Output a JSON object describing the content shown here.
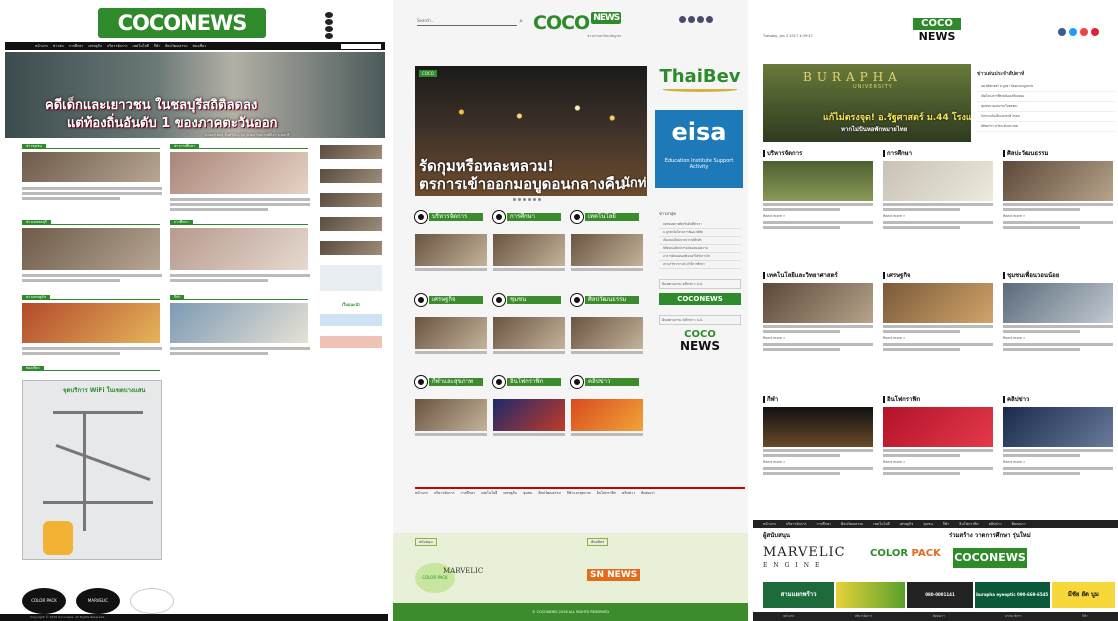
{
  "panel1": {
    "logo": "COCONEWS",
    "nav_items": [
      "หน้าแรก",
      "ข่าวสด",
      "การศึกษา",
      "เศรษฐกิจ",
      "บริหารจัดการ",
      "เทคโนโลยี",
      "กีฬา",
      "ศิลปวัฒนธรรม",
      "ท่องเที่ยว"
    ],
    "hero_caption_1": "คดีเด็กและเยาวชน ในชลบุรีสถิติลดลง",
    "hero_caption_2": "แต่ท้องถิ่นอันดับ 1 ของภาคตะวันออก",
    "hero_caption_small": "นายสุรเชษฐ์ จันทร์เพ็ญ ผู้อำนวยการสถานพินิจฯ จ.ชลบุรี",
    "sections_left": [
      "ข่าวชุมชน",
      "ข่าวเด่นชลบุรี",
      "ข่าวเศรษฐกิจ",
      "ท่องเที่ยว"
    ],
    "sections_right": [
      "ข่าวการศึกษา",
      "การศึกษา",
      "กีฬา"
    ],
    "map_title": "จุดบริการ WiFi ในเขตบางแสน",
    "sidebar_label": "เว็บแนะนำ",
    "footer_logos": [
      "COLOR PACK",
      "MARVELIC",
      ""
    ],
    "footer": "Copyright © 2015 Coconews. All Rights Reserved."
  },
  "panel2": {
    "search_placeholder": "Search...",
    "logo": "COCO",
    "logo_badge": "NEWS",
    "logo_tag": "ข่าวสารมหาวิทยาลัยบูรพา",
    "hero_badge": "COCO",
    "hero_caption_1": "รัดกุมหรือหละหลวม!",
    "hero_caption_2": "ตรการเข้าออกมอบูดอนกลางคืน",
    "hero_caption_3": "นักท่อ",
    "sponsor_1": "ThaiBev",
    "sponsor_2_title": "eisa",
    "sponsor_2_sub": "Education Institute Support Activity",
    "categories": [
      "บริหารจัดการ",
      "การศึกษา",
      "เทคโนโลยี",
      "เศรษฐกิจ",
      "ชุมชน",
      "ศิลปวัฒนธรรม",
      "กีฬาและสุขภาพ",
      "อินโฟกราฟิก",
      "คลิปข่าว"
    ],
    "side_heading": "ข่าวล่าสุด",
    "side_items": [
      "ลดขยะพลาสติกเริ่มต้นที่ตัวเรา",
      "ม.บูรพาจัดโครงการพัฒนานิสิต",
      "เปิดเทอมใหม่บรรยากาศคึกคัก",
      "นิสิตคณะศิลปกรรมจัดแสดงผลงาน",
      "อาจารย์สอนคอมพิวเตอร์ได้รับรางวัล",
      "เสวนาวิชาการประจำปีการศึกษา"
    ],
    "side_box_1": "อินสตาแกรม คลิกข่าว ป.ป.",
    "side_box_2": "อินสตาแกรม คลิกข่าว ป.ป.",
    "side_logo_top": "COCO",
    "side_logo_bottom": "NEWS",
    "menu": [
      "หน้าแรก",
      "บริหารจัดการ",
      "การศึกษา",
      "เทคโนโลยี",
      "เศรษฐกิจ",
      "ชุมชน",
      "ศิลปวัฒนธรรม",
      "กีฬาและสุขภาพ",
      "อินโฟกราฟิก",
      "คลิปข่าว",
      "ติดต่อเรา"
    ],
    "strip_label_1": "สนับสนุน",
    "strip_label_2": "พันธมิตร",
    "strip_colorpack": "COLOR PACK",
    "strip_marvelic": "MARVELIC",
    "strip_sn": "SN NEWS",
    "footer": "© COCONEWS 2016 ALL RIGHTS RESERVED"
  },
  "panel3": {
    "date": "Tuesday, Jan 3 2017 4:39:47",
    "logo_top": "COCO",
    "logo_bottom": "NEWS",
    "hero_uni": "BURAPHA",
    "hero_uni2": "UNIVERSITY",
    "hero_caption_1": "แก้ไม่ตรงจุด! อ.รัฐศาสตร์ ม.44 โรงแรม",
    "hero_caption_2": "หากไม่ปันหอพักหมายไทย",
    "news_heading": "ข่าวเด่นประจำสัปดาห์",
    "news_items": [
      "นศ.นิติศาสตร์ ม.บูรพา จัดอบรมกฎหมาย",
      "เปิดโครงการพี่ช่วยน้องเตรียมสอบ",
      "ชุมชนบางแสนร่วมใจลดขยะ",
      "กิจกรรมวันเด็กแห่งชาติ 2560",
      "นิสิตคว้ารางวัลระดับประเทศ"
    ],
    "sections": [
      "บริหารจัดการ",
      "การศึกษา",
      "ศิลปะวัฒนธรรม",
      "เทคโนโลยีและวิทยาศาสตร์",
      "เศรษฐกิจ",
      "ชุมชนเพื่อนวอนน้อย",
      "กีฬา",
      "อินโฟกราฟิก",
      "คลิปข่าว"
    ],
    "section_captions": [
      "แก้ไม่ตรงจุด!",
      "ม.บูรพาเปิดรับสมัคร",
      "รัฐนาวาคนรุ่นใหม่",
      "เตรียมความพร้อม",
      "ตลาดนัดคลองส่ง",
      "ลิงกอยาละ ต่ำทะเลา",
      "จุดพักคนที่",
      "เปิดสถิติ",
      "นักข่าวอาสา"
    ],
    "read_more": "Read more »",
    "menu": [
      "หน้าแรก",
      "บริหารจัดการ",
      "การศึกษา",
      "ศิลปวัฒนธรรม",
      "เทคโนโลยี",
      "เศรษฐกิจ",
      "ชุมชน",
      "กีฬา",
      "อินโฟกราฟิก",
      "คลิปข่าว",
      "ติดต่อเรา"
    ],
    "sponsor_label": "ผู้สนับสนุน",
    "sponsor_label2": "ร่วมสร้าง วาดการศึกษา รุ่นใหม่",
    "marvelic": "MARVELIC",
    "marvelic_sub": "ENGINE",
    "colorpack_1": "COLOR",
    "colorpack_2": "PACK",
    "coconews": "COCONEWS",
    "banners": [
      "สามแยกพร้าว",
      "",
      "080-0001141",
      "burapha eyeoptic 090-669-6545",
      "มีชัย ยัด บูม"
    ],
    "footer": [
      "หน้าแรก",
      "บริหารจัดการ",
      "ติดต่อเรา",
      "บรรณาธิการ",
      "กีฬา"
    ]
  }
}
